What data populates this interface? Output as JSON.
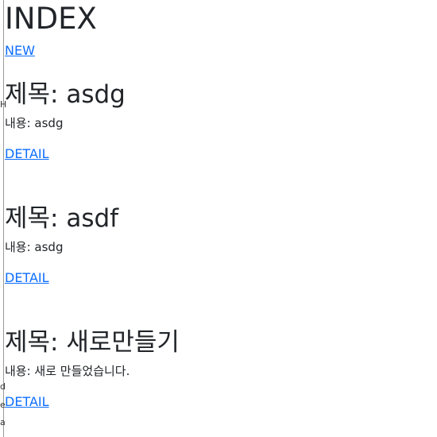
{
  "page": {
    "title": "INDEX",
    "new_link": "NEW"
  },
  "posts": [
    {
      "title": "제목: asdg",
      "body": "내용: asdg",
      "detail_link": "DETAIL"
    },
    {
      "title": "제목: asdf",
      "body": "내용: asdg",
      "detail_link": "DETAIL"
    },
    {
      "title": "제목: 새로만들기",
      "body": "내용: 새로 만들었습니다.",
      "detail_link": "DETAIL"
    }
  ],
  "edge_fragments": [
    "H",
    "d",
    "e",
    "a"
  ]
}
